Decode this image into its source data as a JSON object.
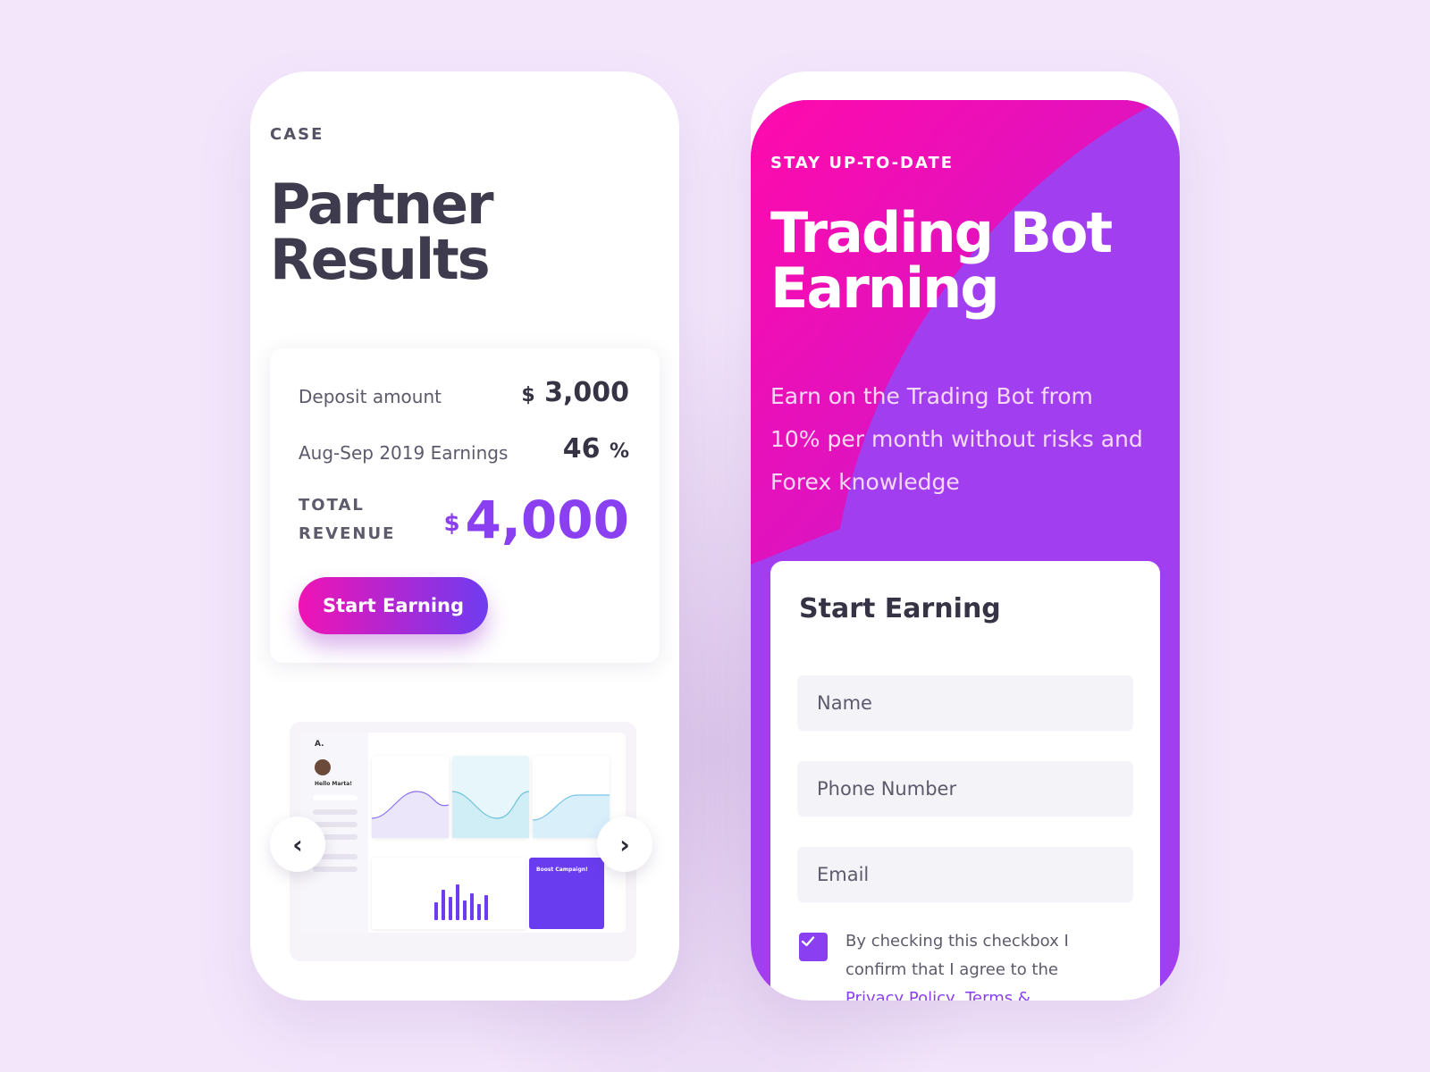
{
  "left": {
    "eyebrow": "CASE",
    "title_line1": "Partner",
    "title_line2": "Results",
    "card": {
      "deposit_label": "Deposit amount",
      "deposit_currency": "$",
      "deposit_value": "3,000",
      "earnings_label": "Aug-Sep 2019 Earnings",
      "earnings_value": "46",
      "earnings_unit": "%",
      "total_label_line1": "TOTAL",
      "total_label_line2": "REVENUE",
      "total_currency": "$",
      "total_value": "4,000",
      "cta_label": "Start Earning"
    },
    "preview": {
      "logo": "A.",
      "greeting": "Hello Marta!",
      "promo": "Boost Campaign!"
    },
    "carousel": {
      "prev_icon": "chevron-left-icon",
      "next_icon": "chevron-right-icon"
    }
  },
  "right": {
    "eyebrow": "STAY UP-TO-DATE",
    "title_line1": "Trading Bot",
    "title_line2": "Earning",
    "description": "Earn on the Trading Bot from 10% per month without risks and Forex knowledge",
    "form": {
      "title": "Start Earning",
      "name_placeholder": "Name",
      "phone_placeholder": "Phone Number",
      "email_placeholder": "Email",
      "checkbox_checked": true,
      "consent_text": "By checking this checkbox I confirm that I agree to the",
      "privacy_link": "Privacy Policy",
      "terms_link": "Terms &"
    }
  },
  "colors": {
    "background": "#f3e6fb",
    "accent_purple": "#8a3ff0",
    "accent_pink": "#f013b4",
    "text_dark": "#3d3b4d"
  }
}
